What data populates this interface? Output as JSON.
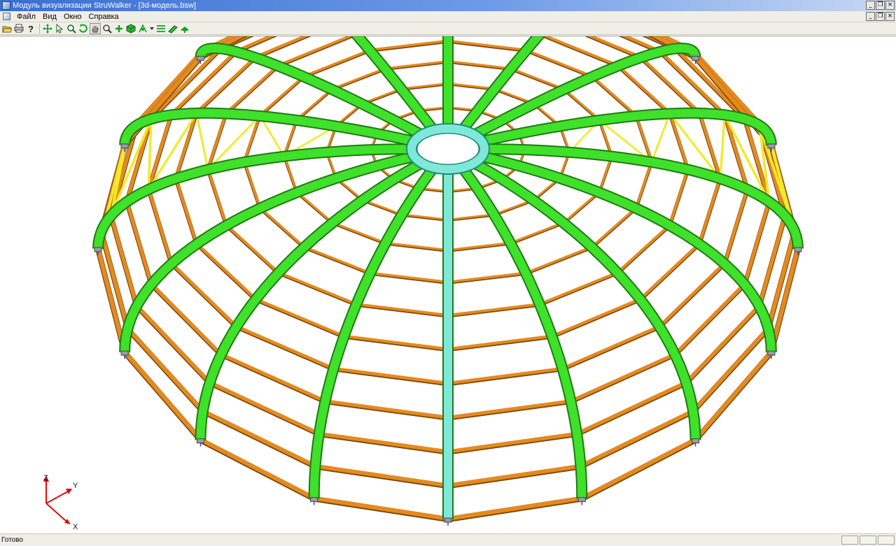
{
  "window": {
    "title": "Модуль визуализации StruWalker - [3d-модель.bsw]"
  },
  "menu": {
    "items": [
      "Файл",
      "Вид",
      "Окно",
      "Справка"
    ]
  },
  "toolbar": {
    "buttons": [
      "open-icon",
      "print-icon",
      "help-icon",
      "move-icon",
      "select-icon",
      "zoom-icon",
      "rotate-icon",
      "pan-hand-icon",
      "zoom-region-icon",
      "add-node-icon",
      "cube-icon",
      "view-options-icon",
      "dropdown-arrow-icon",
      "layers-icon",
      "3d-beam-icon",
      "camera-icon"
    ]
  },
  "axes": {
    "x": "X",
    "y": "Y",
    "z": "Z"
  },
  "colors": {
    "rib_green": "#3fe12a",
    "purlin_orange": "#e68a1e",
    "brace_yellow": "#f2ea2a",
    "ring_cyan": "#7fe8d8",
    "axis_red": "#d81010"
  },
  "status": {
    "text": "Готово"
  }
}
